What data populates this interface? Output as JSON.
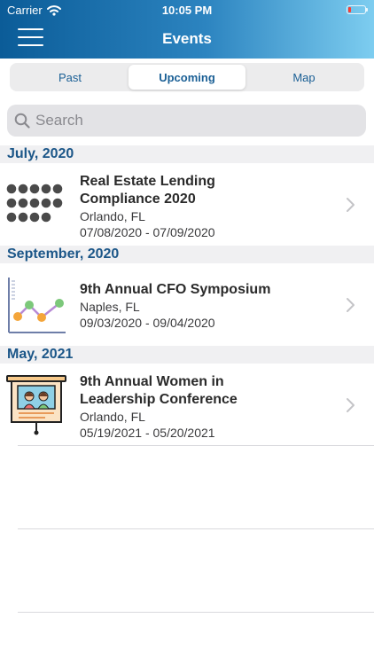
{
  "status_bar": {
    "carrier": "Carrier",
    "time": "10:05 PM"
  },
  "nav": {
    "title": "Events",
    "menu_icon": "hamburger-menu-icon"
  },
  "tabs": [
    {
      "label": "Past",
      "active": false
    },
    {
      "label": "Upcoming",
      "active": true
    },
    {
      "label": "Map",
      "active": false
    }
  ],
  "search": {
    "placeholder": "Search",
    "value": "",
    "icon": "search-icon"
  },
  "sections": [
    {
      "header": "July, 2020",
      "events": [
        {
          "title_line1": "Real Estate Lending",
          "title_line2": "Compliance 2020",
          "location": "Orlando, FL",
          "dates": "07/08/2020 - 07/09/2020",
          "icon": "dot-grid-icon"
        }
      ]
    },
    {
      "header": "September, 2020",
      "events": [
        {
          "title_line1": "9th Annual CFO Symposium",
          "title_line2": "",
          "location": "Naples, FL",
          "dates": "09/03/2020 - 09/04/2020",
          "icon": "line-chart-icon"
        }
      ]
    },
    {
      "header": "May, 2021",
      "events": [
        {
          "title_line1": "9th Annual Women in",
          "title_line2": "Leadership Conference",
          "location": "Orlando, FL",
          "dates": "05/19/2021 - 05/20/2021",
          "icon": "presentation-board-icon"
        }
      ]
    }
  ],
  "colors": {
    "header_gradient_start": "#0b5c98",
    "header_gradient_end": "#7dcdf0",
    "accent": "#1b5688",
    "section_background": "#f0f0f2"
  }
}
